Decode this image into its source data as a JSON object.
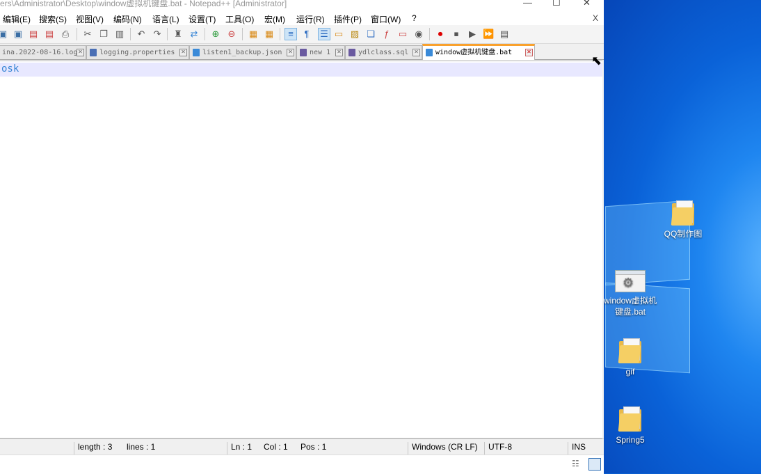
{
  "window": {
    "title": "sers\\Administrator\\Desktop\\window虚拟机键盘.bat - Notepad++ [Administrator]",
    "minimize": "—",
    "maximize": "☐",
    "close": "✕"
  },
  "menu": {
    "items": [
      "编辑(E)",
      "搜索(S)",
      "视图(V)",
      "编码(N)",
      "语言(L)",
      "设置(T)",
      "工具(O)",
      "宏(M)",
      "运行(R)",
      "插件(P)",
      "窗口(W)",
      "?"
    ],
    "close_label": "X"
  },
  "tabs": [
    {
      "label": "ina.2022-08-16.log"
    },
    {
      "label": "logging.properties"
    },
    {
      "label": "listen1_backup.json"
    },
    {
      "label": "new 1"
    },
    {
      "label": "ydlclass.sql"
    },
    {
      "label": "window虚拟机键盘.bat"
    }
  ],
  "editor": {
    "content": "osk"
  },
  "status": {
    "length": "length : 3",
    "lines": "lines : 1",
    "ln": "Ln : 1",
    "col": "Col : 1",
    "pos": "Pos : 1",
    "eol": "Windows (CR LF)",
    "encoding": "UTF-8",
    "mode": "INS"
  },
  "desktop": {
    "icons": [
      {
        "label": "QQ制作图"
      },
      {
        "label": "window虚拟机键盘.bat"
      },
      {
        "label": "gif"
      },
      {
        "label": "Spring5"
      }
    ]
  }
}
